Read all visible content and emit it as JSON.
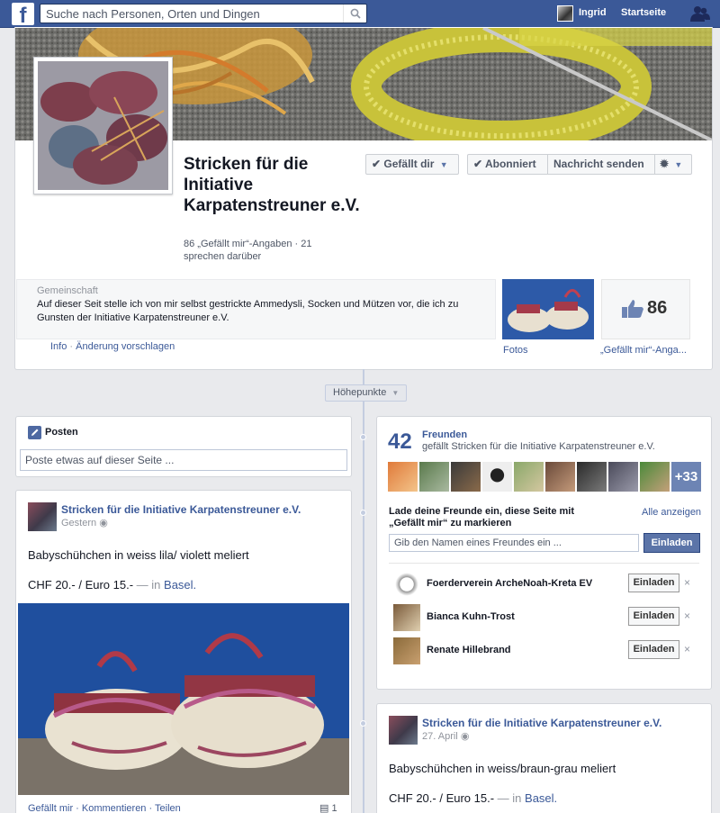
{
  "topbar": {
    "logo_letter": "f",
    "search_placeholder": "Suche nach Personen, Orten und Dingen",
    "user_name": "Ingrid",
    "home_label": "Startseite"
  },
  "page": {
    "name": "Stricken für die Initiative Karpatenstreuner e.V.",
    "stats": "86 „Gefällt mir“-Angaben · 21 sprechen darüber",
    "like_button": "Gefällt dir",
    "subscribe_button": "Abonniert",
    "message_button": "Nachricht senden",
    "category": "Gemeinschaft",
    "about": "Auf dieser Seit stelle ich von mir selbst gestrickte Ammedysli, Socken und Mützen vor, die ich zu Gunsten der Initiative Karpatenstreuner e.V.",
    "info_link": "Info",
    "separator": "·",
    "suggest_link": "Änderung vorschlagen",
    "photos_label": "Fotos",
    "likes_count": "86",
    "likes_label": "„Gefällt mir“-Anga..."
  },
  "highlights_label": "Höhepunkte",
  "composer": {
    "tab_label": "Posten",
    "placeholder": "Poste etwas auf dieser Seite ..."
  },
  "friends_box": {
    "count": "42",
    "title": "Freunden",
    "subtitle": "gefällt Stricken für die Initiative Karpatenstreuner e.V.",
    "more_count": "+33",
    "invite_prompt": "Lade deine Freunde ein, diese Seite mit „Gefällt mir“ zu markieren",
    "show_all": "Alle anzeigen",
    "invite_placeholder": "Gib den Namen eines Freundes ein ...",
    "invite_button": "Einladen",
    "close_glyph": "×",
    "invitees": [
      {
        "name": "Foerderverein ArcheNoah-Kreta EV",
        "button": "Einladen"
      },
      {
        "name": "Bianca Kuhn-Trost",
        "button": "Einladen"
      },
      {
        "name": "Renate Hillebrand",
        "button": "Einladen"
      }
    ]
  },
  "posts": [
    {
      "author": "Stricken für die Initiative Karpatenstreuner e.V.",
      "date": "Gestern",
      "line1": "Babyschühchen in weiss lila/ violett meliert",
      "line2": "CHF 20.- / Euro 15.-",
      "location_prefix": "— in",
      "location": "Basel.",
      "actions": "Gefällt mir · Kommentieren · Teilen",
      "comment_count": "1"
    },
    {
      "author": "Stricken für die Initiative Karpatenstreuner e.V.",
      "date": "27. April",
      "line1": "Babyschühchen in weiss/braun-grau meliert",
      "line2": "CHF 20.- / Euro 15.-",
      "location_prefix": "— in",
      "location": "Basel."
    }
  ],
  "colors": {
    "brand": "#3b5998",
    "background": "#e9eaed",
    "invite_button": "#5b74a8"
  }
}
